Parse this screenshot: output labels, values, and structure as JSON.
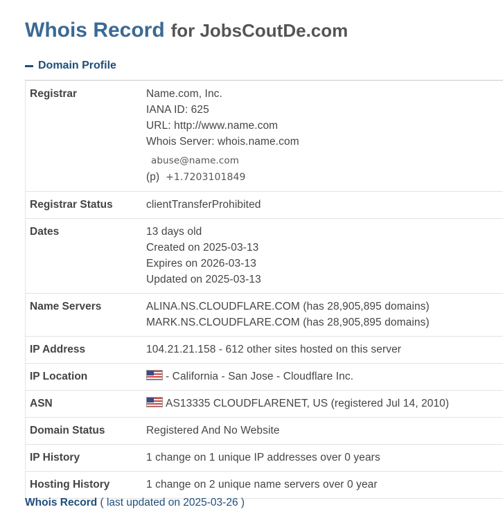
{
  "header": {
    "title": "Whois Record",
    "subtitle": "for JobsCoutDe.com"
  },
  "section": {
    "label": "Domain Profile",
    "icon": "minus-icon"
  },
  "registrar": {
    "label": "Registrar",
    "name": "Name.com, Inc.",
    "iana": "IANA ID: 625",
    "url": "URL: http://www.name.com",
    "whois_server": "Whois Server: whois.name.com",
    "email": "abuse@name.com",
    "phone_prefix": "(p)",
    "phone": "+1.7203101849"
  },
  "registrar_status": {
    "label": "Registrar Status",
    "value": "clientTransferProhibited"
  },
  "dates": {
    "label": "Dates",
    "age": "13 days old",
    "created": "Created on 2025-03-13",
    "expires": "Expires on 2026-03-13",
    "updated": "Updated on 2025-03-13"
  },
  "name_servers": {
    "label": "Name Servers",
    "ns1": "ALINA.NS.CLOUDFLARE.COM (has 28,905,895 domains)",
    "ns2": "MARK.NS.CLOUDFLARE.COM (has 28,905,895 domains)"
  },
  "ip_address": {
    "label": "IP Address",
    "value": "104.21.21.158 - 612 other sites hosted on this server"
  },
  "ip_location": {
    "label": "IP Location",
    "flag_icon": "us-flag-icon",
    "value": "- California - San Jose - Cloudflare Inc."
  },
  "asn": {
    "label": "ASN",
    "flag_icon": "us-flag-icon",
    "value": "AS13335 CLOUDFLARENET, US (registered Jul 14, 2010)"
  },
  "domain_status": {
    "label": "Domain Status",
    "value": "Registered And No Website"
  },
  "ip_history": {
    "label": "IP History",
    "value": "1 change on 1 unique IP addresses over 0 years"
  },
  "hosting_history": {
    "label": "Hosting History",
    "value": "1 change on 2 unique name servers over 0 year"
  },
  "footer": {
    "link": "Whois Record",
    "note": "( last updated on 2025-03-26 )"
  },
  "colors": {
    "title": "#3a6a93",
    "link": "#1f4e79",
    "text": "#444444",
    "border": "#e3e3e3"
  }
}
